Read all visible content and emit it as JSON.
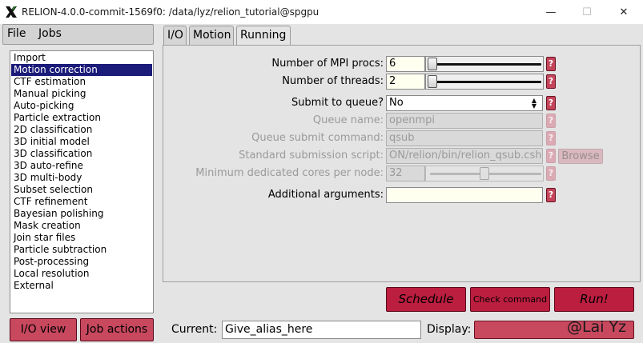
{
  "window": {
    "title": "RELION-4.0.0-commit-1569f0: /data/lyz/relion_tutorial@spgpu",
    "minimize_glyph": "—",
    "maximize_glyph": "☐",
    "close_glyph": "✕"
  },
  "menu": {
    "file": "File",
    "jobs": "Jobs"
  },
  "jobs": {
    "selected_index": 1,
    "items": [
      "Import",
      "Motion correction",
      "CTF estimation",
      "Manual picking",
      "Auto-picking",
      "Particle extraction",
      "2D classification",
      "3D initial model",
      "3D classification",
      "3D auto-refine",
      "3D multi-body",
      "Subset selection",
      "CTF refinement",
      "Bayesian polishing",
      "Mask creation",
      "Join star files",
      "Particle subtraction",
      "Post-processing",
      "Local resolution",
      "External"
    ]
  },
  "tabs": {
    "io": "I/O",
    "motion": "Motion",
    "running": "Running",
    "active": "Running"
  },
  "form": {
    "mpi_label": "Number of MPI procs:",
    "mpi_value": "6",
    "mpi_slider_fraction": 0.0,
    "threads_label": "Number of threads:",
    "threads_value": "2",
    "threads_slider_fraction": 0.0,
    "queue_label": "Submit to queue?",
    "queue_value": "No",
    "queue_name_label": "Queue name:",
    "queue_name_value": "openmpi",
    "queue_cmd_label": "Queue submit command:",
    "queue_cmd_value": "qsub",
    "script_label": "Standard submission script:",
    "script_value": "ON/relion/bin/relion_qsub.csh",
    "browse_label": "Browse",
    "cores_label": "Minimum dedicated cores per node:",
    "cores_value": "32",
    "cores_slider_fraction": 0.5,
    "args_label": "Additional arguments:",
    "args_value": "",
    "help_glyph": "?"
  },
  "actions": {
    "schedule": "Schedule",
    "check": "Check command",
    "run": "Run!"
  },
  "bottom": {
    "io_view": "I/O view",
    "job_actions": "Job actions",
    "current_label": "Current:",
    "current_value": "Give_alias_here",
    "display_label": "Display:",
    "watermark": "@Lai Yz"
  },
  "colors": {
    "selection": "#1b1b7a",
    "action_button": "#bb1e3f",
    "help_button": "#c4455a",
    "input_bg": "#fffff0"
  }
}
